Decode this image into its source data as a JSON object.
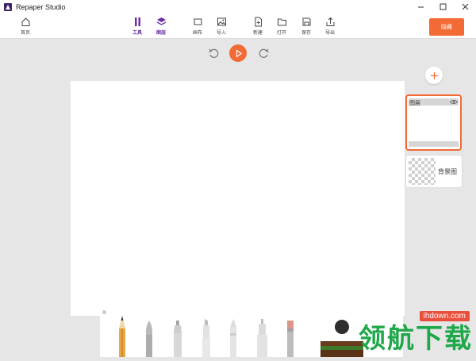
{
  "window": {
    "title": "Repaper Studio"
  },
  "toolbar": {
    "items": [
      {
        "label": "首页",
        "icon": "home-icon"
      },
      {
        "label": "工具",
        "icon": "tools-icon",
        "active": true
      },
      {
        "label": "图层",
        "icon": "layers-icon",
        "active": true
      },
      {
        "label": "画布",
        "icon": "canvas-icon"
      },
      {
        "label": "导入",
        "icon": "import-image-icon"
      },
      {
        "label": "新建",
        "icon": "new-file-icon"
      },
      {
        "label": "打开",
        "icon": "folder-icon"
      },
      {
        "label": "保存",
        "icon": "save-icon"
      },
      {
        "label": "导出",
        "icon": "export-icon"
      }
    ],
    "action_label": "隐藏"
  },
  "playback": {
    "icons": [
      "undo-icon",
      "play-icon",
      "redo-icon"
    ]
  },
  "layers": {
    "items": [
      {
        "name": "图层"
      }
    ],
    "background_label": "背景图"
  },
  "watermark": {
    "domain": "ihdown.com",
    "brand": "领航下载"
  },
  "colors": {
    "accent": "#f26a34",
    "active_tab": "#6b2fa5",
    "workspace": "#e6e6e6"
  }
}
